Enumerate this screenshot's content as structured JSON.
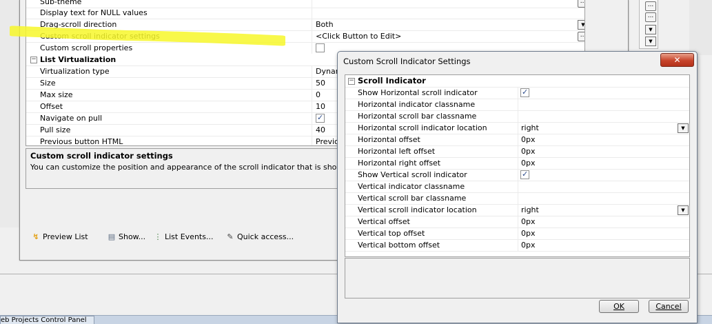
{
  "property_grid": {
    "rows": [
      {
        "name": "Sub-theme",
        "value": ""
      },
      {
        "name": "Display text for NULL values",
        "value": ""
      },
      {
        "name": "Drag-scroll direction",
        "value": "Both"
      },
      {
        "name": "Custom scroll indicator settings",
        "value": "<Click Button to Edit>"
      },
      {
        "name": "Custom scroll properties",
        "value": ""
      },
      {
        "category": "List Virtualization"
      },
      {
        "name": "Virtualization type",
        "value": "Dynam"
      },
      {
        "name": "Size",
        "value": "50"
      },
      {
        "name": "Max size",
        "value": "0"
      },
      {
        "name": "Offset",
        "value": "10"
      },
      {
        "name": "Navigate on pull",
        "value": ""
      },
      {
        "name": "Pull size",
        "value": "40"
      },
      {
        "name": "Previous button HTML",
        "value": "Previou"
      }
    ]
  },
  "description": {
    "title": "Custom scroll indicator settings",
    "text": "You can customize the position and appearance of the scroll indicator that is shown when the"
  },
  "toolbar": {
    "preview": "Preview List",
    "show": "Show...",
    "events": "List Events...",
    "quick": "Quick access..."
  },
  "taskbar": {
    "label": "eb Projects Control Panel"
  },
  "dialog": {
    "title": "Custom Scroll Indicator Settings",
    "close_glyph": "✕",
    "category": "Scroll Indicator",
    "rows": [
      {
        "name": "Show Horizontal scroll indicator",
        "value": ""
      },
      {
        "name": "Horizontal indicator classname",
        "value": ""
      },
      {
        "name": "Horizontal scroll bar classname",
        "value": ""
      },
      {
        "name": "Horizontal scroll indicator location",
        "value": "right"
      },
      {
        "name": "Horizontal offset",
        "value": "0px"
      },
      {
        "name": "Horizontal left offset",
        "value": "0px"
      },
      {
        "name": "Horizontal right offset",
        "value": "0px"
      },
      {
        "name": "Show Vertical scroll indicator",
        "value": ""
      },
      {
        "name": "Vertical indicator classname",
        "value": ""
      },
      {
        "name": "Vertical scroll bar classname",
        "value": ""
      },
      {
        "name": "Vertical scroll indicator location",
        "value": "right"
      },
      {
        "name": "Vertical offset",
        "value": "0px"
      },
      {
        "name": "Vertical top offset",
        "value": "0px"
      },
      {
        "name": "Vertical bottom offset",
        "value": "0px"
      }
    ],
    "ok_label": "OK",
    "cancel_label": "Cancel"
  },
  "icons": {
    "preview": "lightning-icon",
    "show": "window-icon",
    "events": "tree-icon",
    "quick": "edit-icon"
  },
  "colors": {
    "highlight": "#f7f72a",
    "close_button": "#c7442b"
  }
}
